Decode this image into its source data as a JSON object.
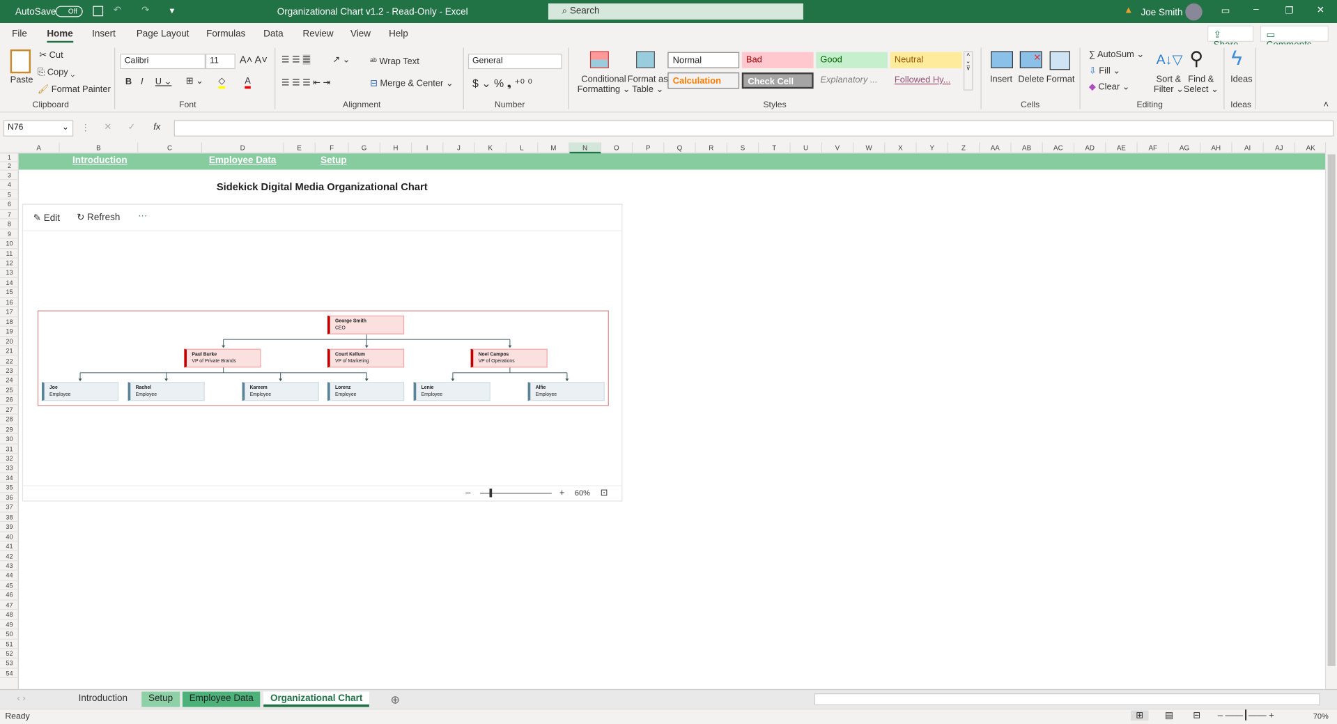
{
  "titlebar": {
    "autosave": "AutoSave",
    "autosave_state": "Off",
    "title": "Organizational Chart v1.2  -  Read-Only  -  Excel",
    "search": "Search",
    "user": "Joe Smith"
  },
  "menu": [
    "File",
    "Home",
    "Insert",
    "Page Layout",
    "Formulas",
    "Data",
    "Review",
    "View",
    "Help"
  ],
  "share": "Share",
  "comments": "Comments",
  "ribbon": {
    "clipboard": {
      "paste": "Paste",
      "cut": "Cut",
      "copy": "Copy",
      "format_painter": "Format Painter",
      "label": "Clipboard"
    },
    "font": {
      "name": "Calibri",
      "size": "11",
      "label": "Font"
    },
    "alignment": {
      "wrap": "Wrap Text",
      "merge": "Merge & Center",
      "label": "Alignment"
    },
    "number": {
      "format": "General",
      "label": "Number"
    },
    "styles": {
      "cond": "Conditional",
      "cond2": "Formatting",
      "fmt_table": "Format as",
      "fmt_table2": "Table",
      "normal": "Normal",
      "bad": "Bad",
      "good": "Good",
      "neutral": "Neutral",
      "calculation": "Calculation",
      "check": "Check Cell",
      "explanatory": "Explanatory ...",
      "followed": "Followed Hy...",
      "label": "Styles"
    },
    "cells": {
      "insert": "Insert",
      "delete": "Delete",
      "format": "Format",
      "label": "Cells"
    },
    "editing": {
      "autosum": "AutoSum",
      "fill": "Fill",
      "clear": "Clear",
      "sort": "Sort &",
      "sort2": "Filter",
      "find": "Find &",
      "find2": "Select",
      "label": "Editing"
    },
    "ideas": {
      "btn": "Ideas",
      "label": "Ideas"
    }
  },
  "namebox": "N76",
  "columns": [
    "A",
    "B",
    "C",
    "D",
    "E",
    "F",
    "G",
    "H",
    "I",
    "J",
    "K",
    "L",
    "M",
    "N",
    "O",
    "P",
    "Q",
    "R",
    "S",
    "T",
    "U",
    "V",
    "W",
    "X",
    "Y",
    "Z",
    "AA",
    "AB",
    "AC",
    "AD",
    "AE",
    "AF",
    "AG",
    "AH",
    "AI",
    "AJ",
    "AK"
  ],
  "links": [
    "Introduction",
    "Employee Data",
    "Setup"
  ],
  "sheet_title": "Sidekick Digital Media Organizational Chart",
  "panel": {
    "edit": "Edit",
    "refresh": "Refresh",
    "more": "···",
    "zoom": "60%"
  },
  "org": {
    "ceo": {
      "name": "George Smith",
      "title": "CEO"
    },
    "vps": [
      {
        "name": "Paul Burke",
        "title": "VP of Private Brands"
      },
      {
        "name": "Court Kellum",
        "title": "VP of Marketing"
      },
      {
        "name": "Noel Campos",
        "title": "VP of Operations"
      }
    ],
    "employees": [
      {
        "name": "Joe",
        "title": "Employee"
      },
      {
        "name": "Rachel",
        "title": "Employee"
      },
      {
        "name": "Kareem",
        "title": "Employee"
      },
      {
        "name": "Lorenz",
        "title": "Employee"
      },
      {
        "name": "Lenie",
        "title": "Employee"
      },
      {
        "name": "Alfie",
        "title": "Employee"
      }
    ]
  },
  "sheets": [
    "Introduction",
    "Setup",
    "Employee Data",
    "Organizational Chart"
  ],
  "status": {
    "ready": "Ready",
    "zoom": "70%"
  }
}
